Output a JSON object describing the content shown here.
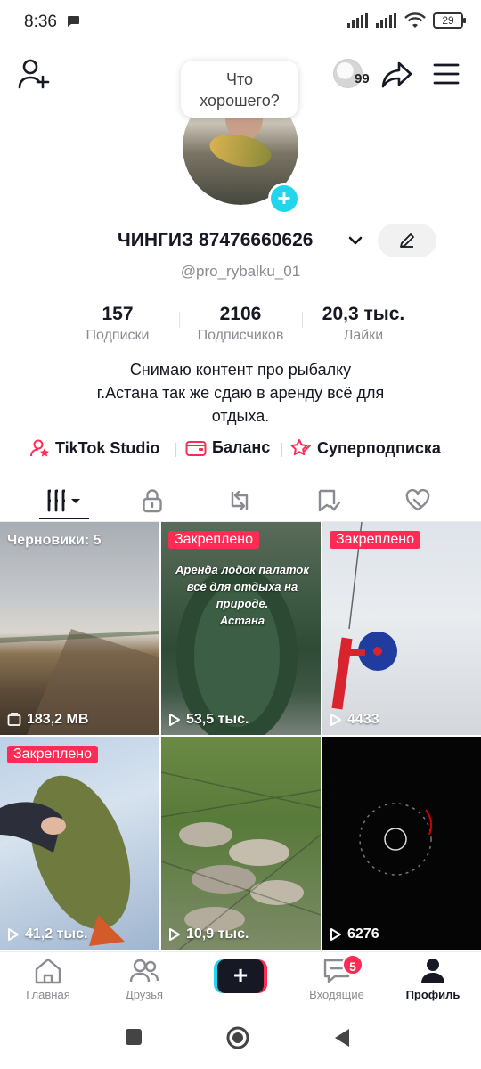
{
  "status_bar": {
    "time": "8:36",
    "battery": "29"
  },
  "header": {
    "coin_count": "99"
  },
  "bubble": {
    "line1": "Что",
    "line2": "хорошего?"
  },
  "profile": {
    "name": "ЧИНГИЗ 87476660626",
    "handle": "@pro_rybalku_01",
    "stats": [
      {
        "value": "157",
        "label": "Подписки"
      },
      {
        "value": "2106",
        "label": "Подписчиков"
      },
      {
        "value": "20,3 тыс.",
        "label": "Лайки"
      }
    ],
    "bio": {
      "line1": "Снимаю контент про рыбалку",
      "line2": "г.Астана так же сдаю в аренду всё для",
      "line3": "отдыха."
    }
  },
  "links": [
    {
      "label": "TikTok Studio",
      "icon": "studio-icon"
    },
    {
      "label": "Баланс",
      "icon": "wallet-icon"
    },
    {
      "label": "Суперподписка",
      "icon": "star-icon"
    }
  ],
  "tabs": [
    "videos-grid-icon",
    "lock-icon",
    "repost-icon",
    "favorites-icon",
    "liked-icon"
  ],
  "videos": [
    {
      "badge": "Черновики: 5",
      "stat": "183,2 MB",
      "stat_icon": "storage-icon"
    },
    {
      "badge": "Закреплено",
      "stat": "53,5 тыс.",
      "overlay_line1": "Аренда лодок палаток",
      "overlay_line2": "всё для отдыха на",
      "overlay_line3": "природе.",
      "overlay_line4": "Астана"
    },
    {
      "badge": "Закреплено",
      "stat": "4433"
    },
    {
      "badge": "Закреплено",
      "stat": "41,2 тыс."
    },
    {
      "stat": "10,9 тыс."
    },
    {
      "stat": "6276"
    }
  ],
  "bottom_nav": {
    "home": "Главная",
    "friends": "Друзья",
    "create": "+",
    "inbox": "Входящие",
    "inbox_badge": "5",
    "profile": "Профиль"
  },
  "colors": {
    "accent": "#fe2c55",
    "cyan": "#20d5ec",
    "text": "#161823",
    "muted": "#8a8b91"
  }
}
